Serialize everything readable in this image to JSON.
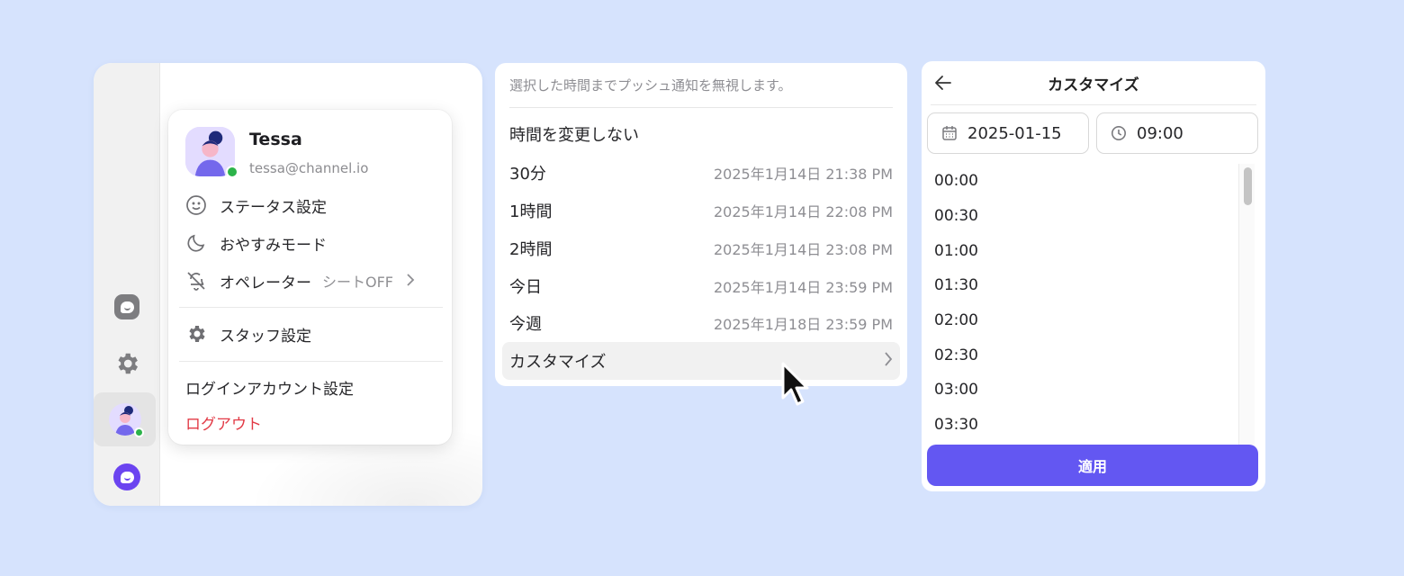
{
  "profile_menu": {
    "name": "Tessa",
    "email": "tessa@channel.io",
    "items": {
      "status": "ステータス設定",
      "dnd": "おやすみモード",
      "operator": "オペレーター",
      "operator_value": "シートOFF",
      "staff": "スタッフ設定",
      "login_account": "ログインアカウント設定",
      "logout": "ログアウト"
    }
  },
  "snooze": {
    "description": "選択した時間までプッシュ通知を無視します。",
    "options": [
      {
        "label": "時間を変更しない",
        "time": ""
      },
      {
        "label": "30分",
        "time": "2025年1月14日 21:38 PM"
      },
      {
        "label": "1時間",
        "time": "2025年1月14日 22:08 PM"
      },
      {
        "label": "2時間",
        "time": "2025年1月14日 23:08 PM"
      },
      {
        "label": "今日",
        "time": "2025年1月14日 23:59 PM"
      },
      {
        "label": "今週",
        "time": "2025年1月18日 23:59 PM"
      }
    ],
    "customize_label": "カスタマイズ"
  },
  "customize": {
    "title": "カスタマイズ",
    "date": "2025-01-15",
    "time": "09:00",
    "times": [
      "00:00",
      "00:30",
      "01:00",
      "01:30",
      "02:00",
      "02:30",
      "03:00",
      "03:30"
    ],
    "apply_label": "適用"
  },
  "colors": {
    "background": "#d6e3fd",
    "accent": "#6357f2",
    "danger": "#e23a46",
    "online": "#2cb34a"
  },
  "icons": [
    "channel-talk-icon",
    "gear-icon",
    "smiley-icon",
    "moon-icon",
    "bell-off-icon",
    "chevron-right-icon",
    "back-arrow-icon",
    "calendar-icon",
    "clock-icon",
    "mouse-pointer-icon"
  ]
}
